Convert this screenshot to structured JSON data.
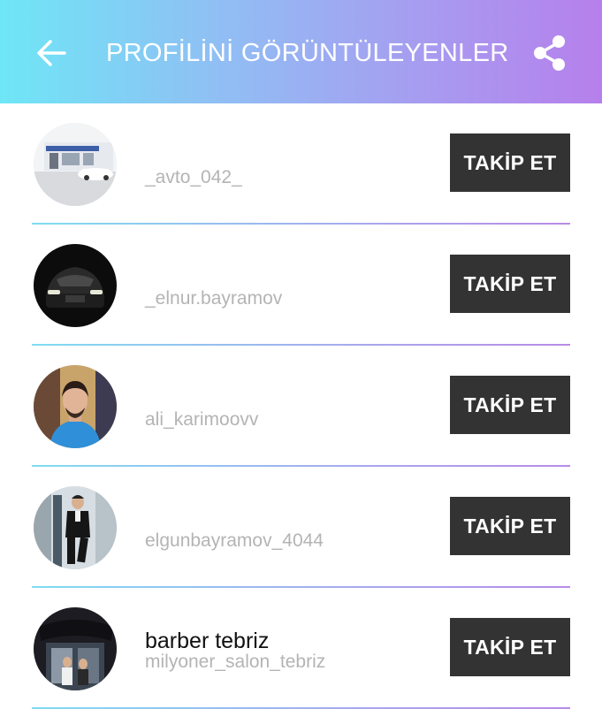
{
  "header": {
    "title": "PROFİLİNİ GÖRÜNTÜLEYENLER",
    "back_icon": "arrow-left-icon",
    "share_icon": "share-icon",
    "gradient": [
      "#6fe6f6",
      "#b680ec"
    ]
  },
  "viewers": [
    {
      "name": "",
      "username": "_avto_042_",
      "follow_label": "TAKİP ET",
      "avatar": "car-shop-photo"
    },
    {
      "name": "",
      "username": "_elnur.bayramov",
      "follow_label": "TAKİP ET",
      "avatar": "black-car-photo"
    },
    {
      "name": "",
      "username": "ali_karimoovv",
      "follow_label": "TAKİP ET",
      "avatar": "man-blue-shirt-photo"
    },
    {
      "name": "",
      "username": "elgunbayramov_4044",
      "follow_label": "TAKİP ET",
      "avatar": "man-suit-photo"
    },
    {
      "name": "barber tebriz",
      "username": "milyoner_salon_tebriz",
      "follow_label": "TAKİP ET",
      "avatar": "salon-photo"
    }
  ],
  "colors": {
    "button_bg": "#333333",
    "username_text": "#b4b4b4",
    "divider": "#a7a9ee"
  }
}
